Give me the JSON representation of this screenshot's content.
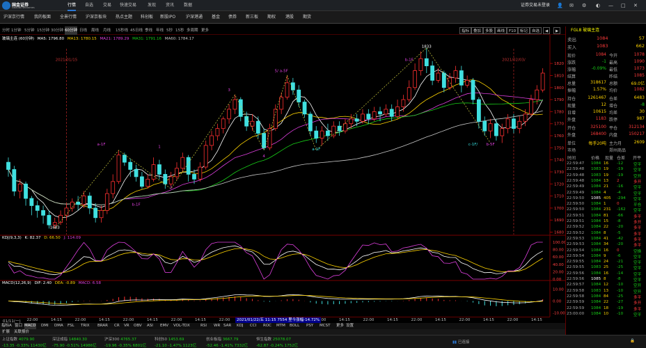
{
  "app": {
    "brand": "国金证券",
    "brand_en": "SINOLINK SECURITIES",
    "login": "证券交易未登录"
  },
  "top_nav": [
    "行情",
    "自选",
    "交易",
    "快速交易",
    "发现",
    "资讯",
    "数据"
  ],
  "tabs2": [
    "沪深京行情",
    "我的板面",
    "全景行情",
    "沪深京板块",
    "热点主题",
    "科创板",
    "新股IPO",
    "沪深港通",
    "基金",
    "债券",
    "新三板",
    "期权",
    "港股",
    "期货"
  ],
  "timeframes": [
    "分时",
    "1分钟",
    "5分钟",
    "15分钟",
    "30分钟",
    "60分钟",
    "日线",
    "周线",
    "月线",
    "15秒线",
    "45日线",
    "季线",
    "年线",
    "5秒",
    "15秒",
    "多周期",
    "更多"
  ],
  "toolbar_right": [
    "指标",
    "叠加",
    "多股",
    "画线",
    "F10",
    "标记",
    "自选"
  ],
  "ma_line": {
    "prefix": "玻璃主连 (60分钟)",
    "items": [
      {
        "t": "MA5: 1796.80",
        "c": "#ffffff"
      },
      {
        "t": "MA13: 1780.15",
        "c": "#ffd400"
      },
      {
        "t": "MA21: 1789.29",
        "c": "#e040e0"
      },
      {
        "t": "MA31: 1791.16",
        "c": "#18d018"
      },
      {
        "t": "MA60: 1784.17",
        "c": "#c8c8c8"
      }
    ]
  },
  "kdj_label": {
    "name": "KDJ(9,3,3)",
    "k": "K: 82.37",
    "d": "D: 66.50",
    "j": "J: 114.09"
  },
  "macd_label": {
    "name": "MACD(12,26,9)",
    "dif": "DIF: 2.40",
    "dea": "DEA: -0.89",
    "macd": "MACD: 6.58"
  },
  "chart_data": {
    "type": "candlestick",
    "series_name": "玻璃主连 (60分钟)",
    "price_axis": [
      1820,
      1810,
      1800,
      1790,
      1780,
      1770,
      1760,
      1750,
      1740,
      1730,
      1720,
      1710,
      1700,
      1690,
      1680
    ],
    "kdj_axis": [
      "100.00",
      "80.00",
      "60.00",
      "40.00",
      "20.00",
      "0.00"
    ],
    "macd_axis": [
      "10.00",
      "0.00",
      "-10.00"
    ],
    "time_axis": [
      "01/11(一)",
      "22:00",
      "14:15",
      "22:00",
      "14:15",
      "22:00",
      "14:15",
      "22:00",
      "14:15",
      "22:00",
      "14:15",
      "22:00",
      "14:15",
      "22:00",
      "14:15",
      "22:00",
      "14:15",
      "22:00",
      "14:15",
      "22:00",
      "14:15",
      "22:00",
      "14:15"
    ],
    "candles": [
      [
        1738,
        1732,
        1726,
        1742
      ],
      [
        1732,
        1714,
        1710,
        1735
      ],
      [
        1714,
        1720,
        1708,
        1724
      ],
      [
        1720,
        1708,
        1702,
        1722
      ],
      [
        1708,
        1702,
        1694,
        1710
      ],
      [
        1702,
        1698,
        1692,
        1706
      ],
      [
        1698,
        1694,
        1687,
        1702
      ],
      [
        1694,
        1686,
        1683,
        1698
      ],
      [
        1686,
        1688,
        1683,
        1692
      ],
      [
        1688,
        1694,
        1686,
        1698
      ],
      [
        1694,
        1700,
        1690,
        1704
      ],
      [
        1700,
        1705,
        1697,
        1708
      ],
      [
        1705,
        1703,
        1698,
        1710
      ],
      [
        1703,
        1710,
        1700,
        1714
      ],
      [
        1710,
        1700,
        1695,
        1713
      ],
      [
        1700,
        1692,
        1688,
        1704
      ],
      [
        1692,
        1698,
        1688,
        1702
      ],
      [
        1698,
        1712,
        1695,
        1716
      ],
      [
        1712,
        1722,
        1708,
        1728
      ],
      [
        1722,
        1744,
        1720,
        1748
      ],
      [
        1744,
        1738,
        1735,
        1746
      ],
      [
        1738,
        1732,
        1726,
        1741
      ],
      [
        1732,
        1726,
        1722,
        1736
      ],
      [
        1726,
        1718,
        1716,
        1730
      ],
      [
        1718,
        1724,
        1716,
        1728
      ],
      [
        1724,
        1736,
        1722,
        1742
      ],
      [
        1736,
        1728,
        1724,
        1740
      ],
      [
        1728,
        1720,
        1716,
        1732
      ],
      [
        1720,
        1726,
        1718,
        1730
      ],
      [
        1726,
        1733,
        1723,
        1738
      ],
      [
        1733,
        1742,
        1730,
        1746
      ],
      [
        1742,
        1728,
        1722,
        1744
      ],
      [
        1728,
        1724,
        1720,
        1732
      ],
      [
        1724,
        1734,
        1722,
        1738
      ],
      [
        1734,
        1752,
        1732,
        1756
      ],
      [
        1752,
        1760,
        1748,
        1764
      ],
      [
        1760,
        1766,
        1756,
        1770
      ],
      [
        1766,
        1774,
        1762,
        1776
      ],
      [
        1774,
        1782,
        1770,
        1786
      ],
      [
        1782,
        1790,
        1778,
        1794
      ],
      [
        1790,
        1776,
        1772,
        1792
      ],
      [
        1776,
        1768,
        1764,
        1780
      ],
      [
        1768,
        1772,
        1764,
        1778
      ],
      [
        1772,
        1762,
        1758,
        1776
      ],
      [
        1762,
        1750,
        1748,
        1766
      ],
      [
        1750,
        1766,
        1748,
        1770
      ],
      [
        1766,
        1782,
        1764,
        1786
      ],
      [
        1782,
        1792,
        1778,
        1796
      ],
      [
        1792,
        1804,
        1790,
        1810
      ],
      [
        1804,
        1798,
        1794,
        1808
      ],
      [
        1798,
        1788,
        1784,
        1802
      ],
      [
        1788,
        1778,
        1775,
        1790
      ],
      [
        1778,
        1764,
        1760,
        1780
      ],
      [
        1764,
        1758,
        1754,
        1768
      ],
      [
        1758,
        1764,
        1752,
        1768
      ],
      [
        1764,
        1760,
        1756,
        1770
      ],
      [
        1760,
        1768,
        1758,
        1772
      ],
      [
        1768,
        1764,
        1760,
        1772
      ],
      [
        1764,
        1770,
        1762,
        1774
      ],
      [
        1770,
        1774,
        1766,
        1778
      ],
      [
        1774,
        1772,
        1768,
        1778
      ],
      [
        1772,
        1778,
        1770,
        1782
      ],
      [
        1778,
        1774,
        1770,
        1782
      ],
      [
        1774,
        1780,
        1772,
        1784
      ],
      [
        1780,
        1778,
        1772,
        1784
      ],
      [
        1778,
        1782,
        1776,
        1786
      ],
      [
        1782,
        1776,
        1772,
        1786
      ],
      [
        1776,
        1784,
        1774,
        1790
      ],
      [
        1784,
        1790,
        1780,
        1794
      ],
      [
        1790,
        1800,
        1788,
        1806
      ],
      [
        1800,
        1814,
        1798,
        1820
      ],
      [
        1814,
        1824,
        1810,
        1830
      ],
      [
        1824,
        1818,
        1812,
        1833
      ],
      [
        1818,
        1806,
        1802,
        1822
      ],
      [
        1806,
        1812,
        1804,
        1816
      ],
      [
        1812,
        1800,
        1796,
        1814
      ],
      [
        1800,
        1808,
        1798,
        1812
      ],
      [
        1808,
        1814,
        1804,
        1818
      ],
      [
        1814,
        1802,
        1796,
        1818
      ],
      [
        1802,
        1806,
        1800,
        1810
      ],
      [
        1806,
        1790,
        1786,
        1808
      ],
      [
        1790,
        1772,
        1766,
        1792
      ],
      [
        1772,
        1764,
        1760,
        1776
      ],
      [
        1764,
        1770,
        1758,
        1774
      ],
      [
        1770,
        1760,
        1756,
        1774
      ],
      [
        1760,
        1766,
        1754,
        1770
      ],
      [
        1766,
        1774,
        1762,
        1778
      ],
      [
        1774,
        1766,
        1762,
        1778
      ],
      [
        1766,
        1772,
        1762,
        1776
      ],
      [
        1772,
        1778,
        1768,
        1782
      ],
      [
        1778,
        1790,
        1776,
        1794
      ],
      [
        1790,
        1798,
        1786,
        1802
      ],
      [
        1798,
        1812,
        1796,
        1816
      ]
    ],
    "annotations": [
      {
        "text": "2021/01/15",
        "price": 1822,
        "bar": 10,
        "color": "#c83232"
      },
      {
        "text": "2021/02/03/",
        "price": 1822,
        "bar": 87,
        "color": "#c83232"
      },
      {
        "text": "5/ a-5F",
        "price": 1813,
        "bar": 47,
        "color": "#e040e0"
      },
      {
        "text": "b-1F",
        "price": 1822,
        "bar": 69,
        "color": "#e040e0"
      },
      {
        "text": "1833",
        "price": 1833,
        "bar": 72,
        "color": "#ffffff"
      },
      {
        "text": "3",
        "price": 1797,
        "bar": 38,
        "color": "#e040e0"
      },
      {
        "text": "a-1F",
        "price": 1752,
        "bar": 16,
        "color": "#e040e0"
      },
      {
        "text": "1",
        "price": 1750,
        "bar": 26,
        "color": "#e040e0"
      },
      {
        "text": "2",
        "price": 1716,
        "bar": 28,
        "color": "#e040e0"
      },
      {
        "text": "b-1F",
        "price": 1702,
        "bar": 22,
        "color": "#e040e0"
      },
      {
        "text": "4",
        "price": 1742,
        "bar": 44,
        "color": "#e040e0"
      },
      {
        "text": "a-1F",
        "price": 1748,
        "bar": 53,
        "color": "#37e0e0"
      },
      {
        "text": "c-1F/",
        "price": 1752,
        "bar": 80,
        "color": "#37e0e0"
      },
      {
        "text": "b-5F",
        "price": 1752,
        "bar": 83,
        "color": "#e040e0"
      },
      {
        "text": "1683",
        "price": 1683,
        "bar": 8,
        "color": "#ffffff"
      }
    ]
  },
  "x_info": "2021/01/22/五 11:15 7554 里今涨幅-14.72%",
  "indicators": [
    "指标A",
    "窗口",
    "MACD",
    "DMI",
    "DMA",
    "FSL",
    "TRIX",
    "BRAR",
    "CR",
    "VR",
    "OBV",
    "ASI",
    "EMV",
    "VOL-TDX",
    "RSI",
    "WR",
    "SAR",
    "KDJ",
    "CCI",
    "ROC",
    "MTM",
    "BOLL",
    "PSY",
    "MCST",
    "更多",
    "设置"
  ],
  "sub_tabs": [
    "扩展",
    "关联报价"
  ],
  "status_lines": [
    {
      "l": "上证指数",
      "v": "4079.90",
      "c": "-13.35 -0.33% 11430亿"
    },
    {
      "l": "深证成指",
      "v": "14840.30",
      "c": "-75.90 -0.51% 14986亿"
    },
    {
      "l": "沪深300",
      "v": "4765.37",
      "c": "-19.96 -0.35% 6801亿"
    },
    {
      "l": "科创50",
      "v": "1453.69",
      "c": "-21.10 -1.47% 1123亿"
    },
    {
      "l": "创业板指",
      "v": "3667.79",
      "c": "-52.46 -1.41% 7332亿"
    },
    {
      "l": "恒生指数",
      "v": "25078.07",
      "c": "-62.87 -0.24% 1752亿"
    }
  ],
  "status_right": "已连接",
  "rp": {
    "title": "FGL8  玻璃主连",
    "orderbook": [
      {
        "l": "卖出",
        "p": "1084",
        "v": "57"
      },
      {
        "l": "买入",
        "p": "1083",
        "v": "662"
      }
    ],
    "quote": [
      [
        "现价",
        "1084",
        "今开",
        "1078"
      ],
      [
        "涨跌",
        "-1",
        "最高",
        "1090"
      ],
      [
        "涨幅",
        "-0.09%",
        "最低",
        "1073"
      ],
      [
        "结算",
        "",
        "昨结",
        "1085"
      ],
      [
        "总量",
        "318617",
        "总额",
        "69.0亿"
      ],
      [
        "振幅",
        "1.57%",
        "均价",
        "1082"
      ],
      [
        "持仓",
        "1261467",
        "仓差",
        "6483"
      ],
      [
        "现量",
        "12",
        "增仓",
        "-8"
      ],
      [
        "日增",
        "10615",
        "均差",
        "30"
      ],
      [
        "外盘",
        "1183",
        "跌停",
        "987"
      ],
      [
        "开仓",
        "325100",
        "平仓",
        "312134"
      ],
      [
        "外盘",
        "168400",
        "内盘",
        "150217"
      ],
      [
        "单位",
        "每手20吨",
        "主力月",
        "2609"
      ],
      [
        "市场",
        "",
        "郑州商品",
        ""
      ]
    ],
    "trade_headers": [
      "时间",
      "价格",
      "现量",
      "仓差",
      "开平"
    ],
    "trades": [
      [
        "22:59:47",
        "1084",
        "16",
        "-12",
        "空平"
      ],
      [
        "22:59:48",
        "1083",
        "19",
        "-19",
        "空平"
      ],
      [
        "22:59:48",
        "1083",
        "19",
        "-19",
        "空开"
      ],
      [
        "22:59:48",
        "1084",
        "13",
        "2",
        "多开"
      ],
      [
        "22:59:49",
        "1084",
        "21",
        "-16",
        "空平"
      ],
      [
        "22:59:49",
        "1084",
        "4",
        "-4",
        "空平"
      ],
      [
        "22:59:50",
        "1085",
        "405",
        "-294",
        "空平"
      ],
      [
        "22:59:50",
        "1084",
        "1",
        "0",
        "平仓"
      ],
      [
        "22:59:50",
        "1084",
        "231",
        "-162",
        "空平"
      ],
      [
        "22:59:51",
        "1084",
        "81",
        "-66",
        "多平"
      ],
      [
        "22:59:51",
        "1084",
        "15",
        "-8",
        "多开"
      ],
      [
        "22:59:52",
        "1084",
        "22",
        "-20",
        "多平"
      ],
      [
        "22:59:52",
        "1084",
        "8",
        "-5",
        "多平"
      ],
      [
        "22:59:53",
        "1084",
        "41",
        "-42",
        "多平"
      ],
      [
        "22:59:53",
        "1084",
        "34",
        "-20",
        "多平"
      ],
      [
        "22:59:54",
        "1084",
        "16",
        "0",
        "空换"
      ],
      [
        "22:59:54",
        "1084",
        "9",
        "-6",
        "空平"
      ],
      [
        "22:59:55",
        "1084",
        "24",
        "-21",
        "空平"
      ],
      [
        "22:59:55",
        "1083",
        "25",
        "-25",
        "空平"
      ],
      [
        "22:59:56",
        "1084",
        "16",
        "-14",
        "空平"
      ],
      [
        "22:59:56",
        "1085",
        "8",
        "-8",
        "空平"
      ],
      [
        "22:59:57",
        "1084",
        "12",
        "-10",
        "空开"
      ],
      [
        "22:59:58",
        "1083",
        "13",
        "-10",
        "空开"
      ],
      [
        "22:59:58",
        "1084",
        "84",
        "-25",
        "多平"
      ],
      [
        "22:59:59",
        "1084",
        "22",
        "-27",
        "多开"
      ],
      [
        "22:59:59",
        "1084",
        "18",
        "-19",
        "多平"
      ],
      [
        "23:00:00",
        "1084",
        "10",
        "-10",
        "空平"
      ]
    ]
  }
}
